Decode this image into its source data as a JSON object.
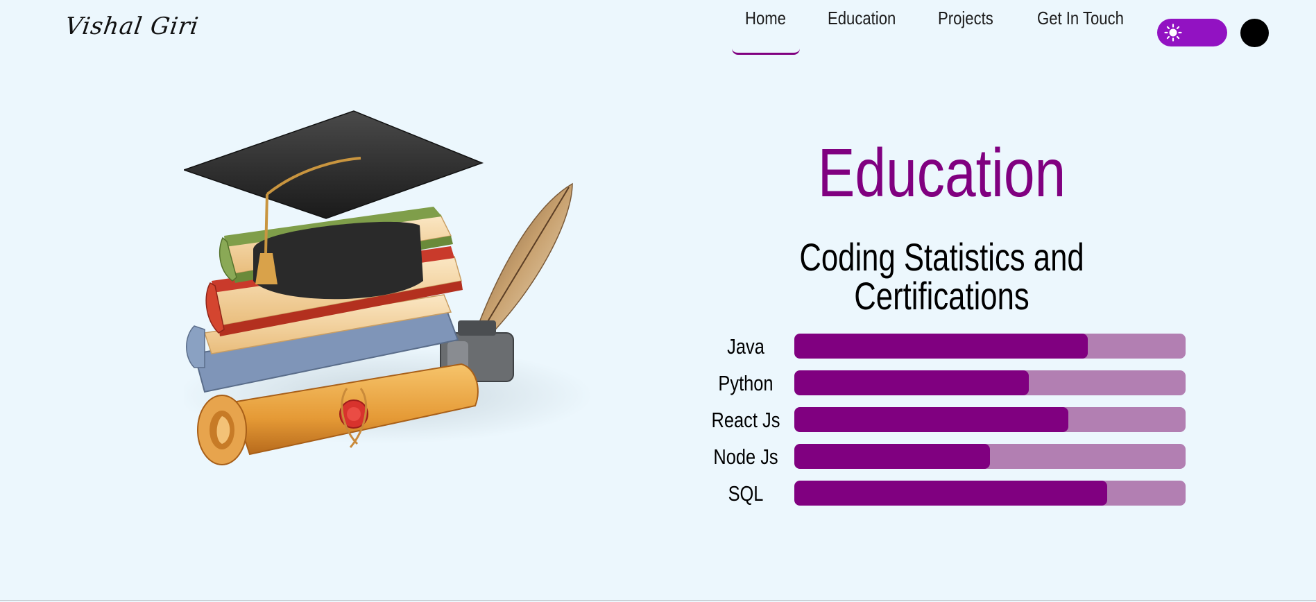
{
  "header": {
    "logo": "Vishal Giri",
    "nav": [
      {
        "label": "Home",
        "active": true
      },
      {
        "label": "Education",
        "active": false
      },
      {
        "label": "Projects",
        "active": false
      },
      {
        "label": "Get In Touch",
        "active": false
      }
    ],
    "theme_toggle_icon": "sun-icon"
  },
  "main": {
    "title": "Education",
    "subtitle": "Coding Statistics and Certifications",
    "skills": [
      {
        "label": "Java",
        "percent": 75
      },
      {
        "label": "Python",
        "percent": 60
      },
      {
        "label": "React Js",
        "percent": 70
      },
      {
        "label": "Node Js",
        "percent": 50
      },
      {
        "label": "SQL",
        "percent": 80
      }
    ]
  },
  "colors": {
    "accent": "#800080",
    "track": "#b27fb2",
    "toggle": "#9212c2",
    "background": "#ecf7fd"
  }
}
